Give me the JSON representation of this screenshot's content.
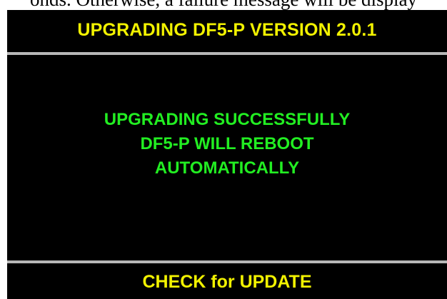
{
  "document": {
    "caption_fragment": "onds. Otherwise, a failure message will be display"
  },
  "screen": {
    "header": {
      "title": "UPGRADING DF5-P VERSION 2.0.1"
    },
    "status": {
      "lines": [
        "UPGRADING SUCCESSFULLY",
        "DF5-P WILL REBOOT",
        "AUTOMATICALLY"
      ]
    },
    "footer": {
      "button_label": "CHECK for UPDATE"
    }
  },
  "colors": {
    "background": "#000000",
    "header_text": "#f2f200",
    "status_text": "#22ee22",
    "divider": "#b7b7b7"
  }
}
